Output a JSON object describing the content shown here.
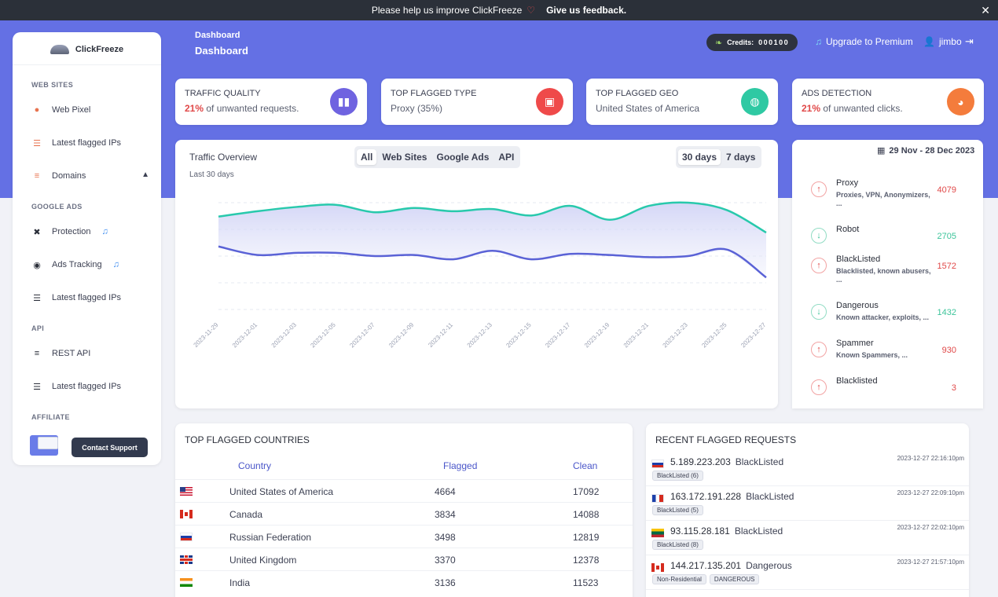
{
  "banner": {
    "text": "Please help us improve ClickFreeze",
    "feedback": "Give us feedback.",
    "close": "✕"
  },
  "sidebar": {
    "brand": "ClickFreeze",
    "sections": {
      "websites": "WEB SITES",
      "google_ads": "GOOGLE ADS",
      "api": "API",
      "affiliate": "AFFILIATE"
    },
    "items": {
      "web_pixel": "Web Pixel",
      "latest_ips_1": "Latest flagged IPs",
      "domains": "Domains",
      "protection": "Protection",
      "ads_tracking": "Ads Tracking",
      "latest_ips_2": "Latest flagged IPs",
      "rest_api": "REST API",
      "latest_ips_3": "Latest flagged IPs"
    },
    "contact_support": "Contact Support"
  },
  "header": {
    "breadcrumb": "Dashboard",
    "title": "Dashboard",
    "credits_label": "Credits:",
    "credits_value": "000100",
    "upgrade": "Upgrade to Premium",
    "user": "jimbo"
  },
  "stats": [
    {
      "title": "TRAFFIC QUALITY",
      "pct": "21%",
      "text": " of unwanted requests.",
      "color": "#6f63e0"
    },
    {
      "title": "TOP FLAGGED TYPE",
      "pct": "",
      "text": "Proxy (35%)",
      "color": "#ef4a4a"
    },
    {
      "title": "TOP FLAGGED GEO",
      "pct": "",
      "text": "United States of America",
      "color": "#2fc9a3"
    },
    {
      "title": "ADS DETECTION",
      "pct": "21%",
      "text": " of unwanted clicks.",
      "color": "#f47c3c"
    }
  ],
  "traffic": {
    "title": "Traffic Overview",
    "subtitle": "Last 30 days",
    "filters": [
      "All",
      "Web Sites",
      "Google Ads",
      "API"
    ],
    "ranges": [
      "30 days",
      "7 days"
    ]
  },
  "chart_data": {
    "type": "area",
    "x": [
      "2023-11-29",
      "2023-12-01",
      "2023-12-03",
      "2023-12-05",
      "2023-12-07",
      "2023-12-09",
      "2023-12-11",
      "2023-12-13",
      "2023-12-15",
      "2023-12-17",
      "2023-12-19",
      "2023-12-21",
      "2023-12-23",
      "2023-12-25",
      "2023-12-27"
    ],
    "series": [
      {
        "values": [
          0.87,
          0.92,
          0.96,
          0.98,
          0.91,
          0.95,
          0.92,
          0.94,
          0.88,
          0.97,
          0.84,
          0.97,
          1.0,
          0.93,
          0.72
        ],
        "color": "#28c9ac"
      },
      {
        "values": [
          0.59,
          0.51,
          0.53,
          0.53,
          0.5,
          0.51,
          0.47,
          0.55,
          0.47,
          0.52,
          0.51,
          0.49,
          0.5,
          0.56,
          0.3
        ],
        "color": "#5a62d6"
      }
    ],
    "xlabel": "",
    "ylabel": ""
  },
  "threats": {
    "date_range": "29 Nov - 28 Dec 2023",
    "items": [
      {
        "name": "Proxy",
        "desc": "Proxies, VPN, Anonymizers, ...",
        "count": "4079",
        "trend": "up"
      },
      {
        "name": "Robot",
        "desc": "",
        "count": "2705",
        "trend": "down"
      },
      {
        "name": "BlackListed",
        "desc": "Blacklisted, known abusers, ...",
        "count": "1572",
        "trend": "up"
      },
      {
        "name": "Dangerous",
        "desc": "Known attacker, exploits, ...",
        "count": "1432",
        "trend": "down"
      },
      {
        "name": "Spammer",
        "desc": "Known Spammers, ...",
        "count": "930",
        "trend": "up"
      },
      {
        "name": "Blacklisted",
        "desc": "",
        "count": "3",
        "trend": "up"
      }
    ]
  },
  "countries": {
    "title": "TOP FLAGGED COUNTRIES",
    "headers": [
      "Country",
      "Flagged",
      "Clean"
    ],
    "rows": [
      {
        "flag": "us",
        "name": "United States of America",
        "flagged": "4664",
        "clean": "17092"
      },
      {
        "flag": "ca",
        "name": "Canada",
        "flagged": "3834",
        "clean": "14088"
      },
      {
        "flag": "ru",
        "name": "Russian Federation",
        "flagged": "3498",
        "clean": "12819"
      },
      {
        "flag": "gb",
        "name": "United Kingdom",
        "flagged": "3370",
        "clean": "12378"
      },
      {
        "flag": "in",
        "name": "India",
        "flagged": "3136",
        "clean": "11523"
      }
    ]
  },
  "recent": {
    "title": "RECENT FLAGGED REQUESTS",
    "rows": [
      {
        "flag": "ru",
        "ip": "5.189.223.203",
        "type": "BlackListed",
        "time": "2023-12-27 22:16:10pm",
        "tags": [
          "BlackListed (6)"
        ]
      },
      {
        "flag": "fr",
        "ip": "163.172.191.228",
        "type": "BlackListed",
        "time": "2023-12-27 22:09:10pm",
        "tags": [
          "BlackListed (5)"
        ]
      },
      {
        "flag": "lt",
        "ip": "93.115.28.181",
        "type": "BlackListed",
        "time": "2023-12-27 22:02:10pm",
        "tags": [
          "BlackListed (8)"
        ]
      },
      {
        "flag": "ca",
        "ip": "144.217.135.201",
        "type": "Dangerous",
        "time": "2023-12-27 21:57:10pm",
        "tags": [
          "Non-Residential",
          "DANGEROUS"
        ]
      }
    ]
  }
}
